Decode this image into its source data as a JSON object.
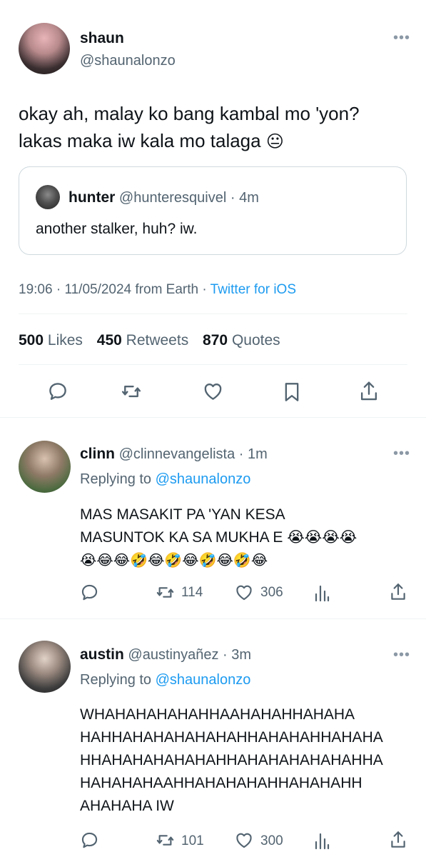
{
  "main_tweet": {
    "display_name": "shaun",
    "handle": "@shaunalonzo",
    "text_line1": "okay ah, malay ko bang kambal mo 'yon?",
    "text_line2": "lakas maka iw kala mo talaga",
    "emoji": "😐",
    "quoted": {
      "display_name": "hunter",
      "handle": "@hunteresquivel",
      "separator": "·",
      "time": "4m",
      "text": "another stalker, huh? iw."
    },
    "meta": {
      "time": "19:06",
      "dot1": "·",
      "date": "11/05/2024",
      "location": "from Earth",
      "dot2": "·",
      "client": "Twitter for iOS"
    },
    "stats": {
      "likes_count": "500",
      "likes_label": "Likes",
      "retweets_count": "450",
      "retweets_label": "Retweets",
      "quotes_count": "870",
      "quotes_label": "Quotes"
    }
  },
  "replies": [
    {
      "display_name": "clinn",
      "handle": "@clinnevangelista",
      "separator": "·",
      "time": "1m",
      "replying_prefix": "Replying to",
      "replying_to": "@shaunalonzo",
      "text_line1": "MAS MASAKIT PA 'YAN KESA",
      "text_line2": "MASUNTOK KA SA MUKHA E 😭😭😭😭",
      "text_line3": "😭😂😂🤣😂🤣😂🤣😂🤣😂",
      "retweets": "114",
      "likes": "306"
    },
    {
      "display_name": "austin",
      "handle": "@austinyañez",
      "separator": "·",
      "time": "3m",
      "replying_prefix": "Replying to",
      "replying_to": "@shaunalonzo",
      "text_lines": [
        "WHAHAHAHAHAHHAAHAHAHHAHAHA",
        "HAHHAHAHAHAHAHAHHAHAHAHHAHAHA",
        "HHAHAHAHAHAHAHHAHAHAHAHAHAHHA",
        "HAHAHAHAAHHAHAHAHAHHAHAHAHH",
        "AHAHAHA IW"
      ],
      "retweets": "101",
      "likes": "300"
    }
  ],
  "icons": {
    "more": "more-icon",
    "reply": "reply-icon",
    "retweet": "retweet-icon",
    "like": "heart-icon",
    "bookmark": "bookmark-icon",
    "share": "share-icon",
    "views": "views-icon"
  },
  "colors": {
    "accent": "#1d9bf0",
    "text": "#0f1419",
    "muted": "#536471",
    "divider": "#eff3f4"
  }
}
